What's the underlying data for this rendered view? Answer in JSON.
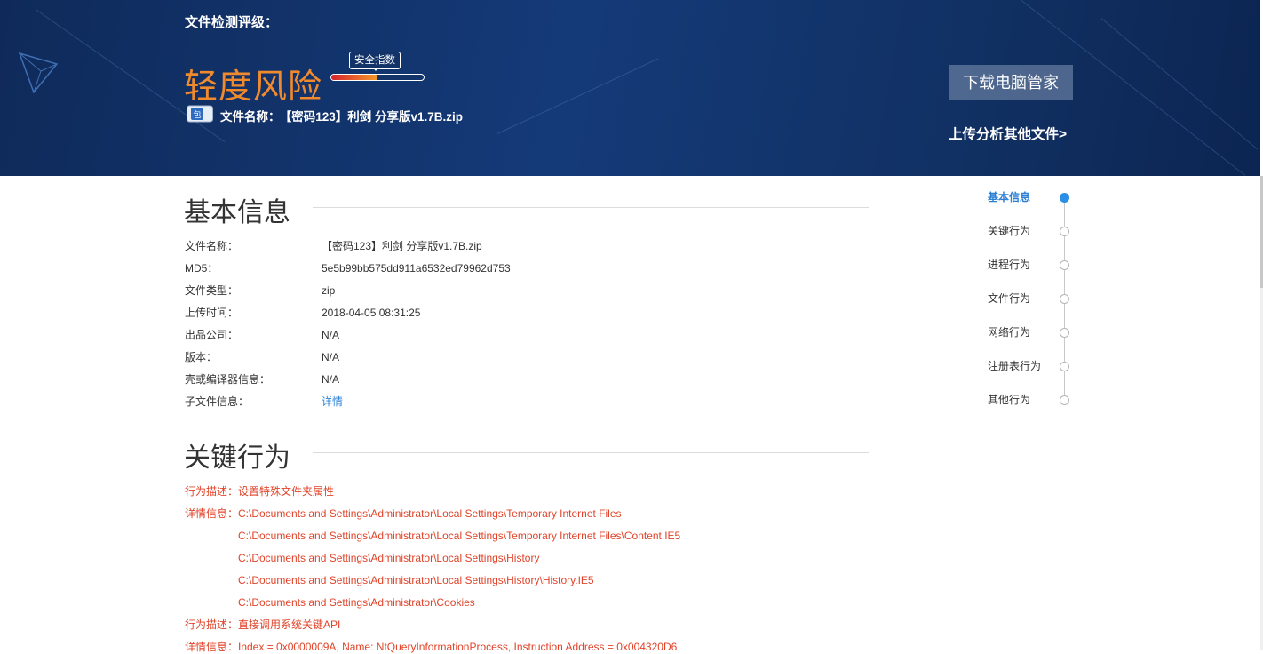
{
  "banner": {
    "rating_label": "文件检测评级：",
    "risk_level": "轻度风险",
    "safety_index_label": "安全指数",
    "safety_index_level": 0.5,
    "file_icon_char": "包",
    "file_name_label": "文件名称：",
    "file_name": "【密码123】利剑 分享版v1.7B.zip",
    "download_button": "下载电脑管家",
    "upload_link": "上传分析其他文件>",
    "colors": {
      "risk": "#f08a2c",
      "bg": "#143a78"
    }
  },
  "basic_info": {
    "title": "基本信息",
    "rows": [
      {
        "label": "文件名称：",
        "value": "【密码123】利剑 分享版v1.7B.zip"
      },
      {
        "label": "MD5：",
        "value": "5e5b99bb575dd911a6532ed79962d753"
      },
      {
        "label": "文件类型：",
        "value": "zip"
      },
      {
        "label": "上传时间：",
        "value": "2018-04-05 08:31:25"
      },
      {
        "label": "出品公司：",
        "value": "N/A"
      },
      {
        "label": "版本：",
        "value": "N/A"
      },
      {
        "label": "壳或编译器信息：",
        "value": "N/A"
      },
      {
        "label": "子文件信息：",
        "value": "详情"
      }
    ]
  },
  "key_behavior": {
    "title": "关键行为",
    "rows": [
      {
        "label": "行为描述：",
        "value": "设置特殊文件夹属性"
      },
      {
        "label": "详情信息：",
        "value": "C:\\Documents and Settings\\Administrator\\Local Settings\\Temporary Internet Files"
      },
      {
        "label": "",
        "value": "C:\\Documents and Settings\\Administrator\\Local Settings\\Temporary Internet Files\\Content.IE5"
      },
      {
        "label": "",
        "value": "C:\\Documents and Settings\\Administrator\\Local Settings\\History"
      },
      {
        "label": "",
        "value": "C:\\Documents and Settings\\Administrator\\Local Settings\\History\\History.IE5"
      },
      {
        "label": "",
        "value": "C:\\Documents and Settings\\Administrator\\Cookies"
      },
      {
        "label": "行为描述：",
        "value": "直接调用系统关键API"
      },
      {
        "label": "详情信息：",
        "value": "Index = 0x0000009A, Name: NtQueryInformationProcess, Instruction Address = 0x004320D6"
      }
    ],
    "colors": {
      "text": "#e0442a"
    }
  },
  "side_nav": {
    "items": [
      {
        "label": "基本信息",
        "active": true
      },
      {
        "label": "关键行为",
        "active": false
      },
      {
        "label": "进程行为",
        "active": false
      },
      {
        "label": "文件行为",
        "active": false
      },
      {
        "label": "网络行为",
        "active": false
      },
      {
        "label": "注册表行为",
        "active": false
      },
      {
        "label": "其他行为",
        "active": false
      }
    ],
    "colors": {
      "active": "#2a7fd4"
    }
  }
}
